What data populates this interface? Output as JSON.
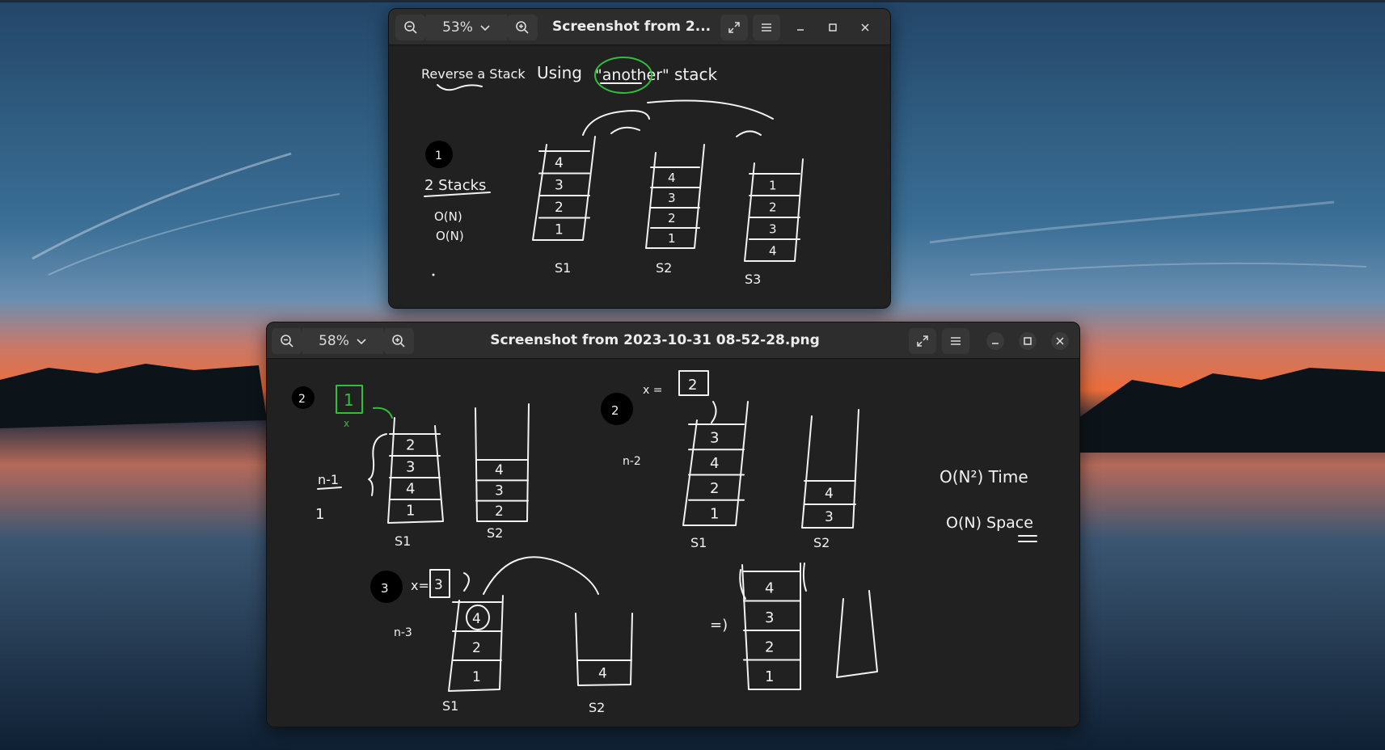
{
  "colors": {
    "sky_top": "#2b4f74",
    "sky_horizon": "#e07a4a",
    "water": "#0f2235",
    "ink": "#f2f2f2",
    "green_ink": "#2fbf3b",
    "window_bg": "#212121",
    "titlebar_bg": "#2d2d2d"
  },
  "window_top": {
    "title": "Screenshot from 2...",
    "zoom": "53%",
    "icons": [
      "zoom-out-icon",
      "chevron-down-icon",
      "zoom-in-icon",
      "fullscreen-icon",
      "menu-icon",
      "minimize-icon",
      "maximize-icon",
      "close-icon"
    ],
    "image": {
      "heading": "Reverse a Stack",
      "using": "Using",
      "another": "\"another\"",
      "stack_word": "stack",
      "step": "1",
      "two_stacks": "2 Stacks",
      "complexity_time": "O(N)",
      "complexity_space": "O(N)",
      "s1_items": [
        "4",
        "3",
        "2",
        "1"
      ],
      "s2_items": [
        "4",
        "3",
        "2",
        "1"
      ],
      "s3_items": [
        "1",
        "2",
        "3",
        "4"
      ],
      "s1_label": "S1",
      "s2_label": "S2",
      "s3_label": "S3"
    }
  },
  "window_bottom": {
    "title": "Screenshot from 2023-10-31 08-52-28.png",
    "zoom": "58%",
    "icons": [
      "zoom-out-icon",
      "chevron-down-icon",
      "zoom-in-icon",
      "fullscreen-icon",
      "menu-icon",
      "minimize-icon",
      "maximize-icon",
      "close-icon"
    ],
    "image": {
      "step_a": "2",
      "boxed_a": "1",
      "x_mark": "x",
      "n_minus_1": "n-1",
      "one": "1",
      "a_s1_items": [
        "2",
        "3",
        "4",
        "1"
      ],
      "a_s2_items": [
        "4",
        "3",
        "2"
      ],
      "s1_label": "S1",
      "s2_label": "S2",
      "step_b": "2",
      "x_eq": "x =",
      "boxed_b": "2",
      "n_minus_2": "n-2",
      "b_s1_items": [
        "3",
        "4",
        "2",
        "1"
      ],
      "b_s2_items": [
        "4",
        "3"
      ],
      "time_complexity": "O(N²) Time",
      "space_complexity": "O(N) Space",
      "step_c": "3",
      "x_eq_c": "x=",
      "boxed_c": "3",
      "n_minus_3": "n-3",
      "c_s1_items": [
        "4",
        "2",
        "1"
      ],
      "c_s2_items": [
        "4"
      ],
      "implies": "=)",
      "d_items": [
        "4",
        "3",
        "2",
        "1"
      ]
    }
  }
}
